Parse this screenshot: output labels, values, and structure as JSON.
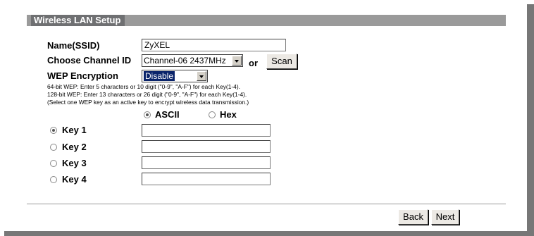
{
  "section_title": "Wireless LAN Setup",
  "ssid": {
    "label": "Name(SSID)",
    "value": "ZyXEL"
  },
  "channel": {
    "label": "Choose Channel ID",
    "selected": "Channel-06 2437MHz",
    "or_text": "or",
    "scan_label": "Scan"
  },
  "wep": {
    "label": "WEP Encryption",
    "selected": "Disable",
    "help": [
      "64-bit WEP: Enter 5 characters or 10 digit (\"0-9\", \"A-F\") for each Key(1-4).",
      "128-bit WEP: Enter 13 characters or 26 digit (\"0-9\", \"A-F\") for each Key(1-4).",
      "(Select one WEP key as an active key to encrypt wireless data transmission.)"
    ],
    "format_options": {
      "ascii": "ASCII",
      "hex": "Hex",
      "selected": "ascii"
    },
    "keys": [
      {
        "label": "Key 1",
        "value": "",
        "selected": true
      },
      {
        "label": "Key 2",
        "value": "",
        "selected": false
      },
      {
        "label": "Key 3",
        "value": "",
        "selected": false
      },
      {
        "label": "Key 4",
        "value": "",
        "selected": false
      }
    ]
  },
  "buttons": {
    "back": "Back",
    "next": "Next"
  }
}
